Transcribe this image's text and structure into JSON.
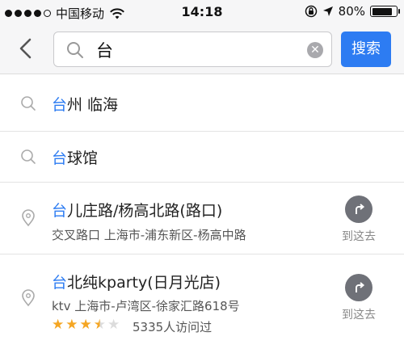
{
  "status_bar": {
    "carrier": "中国移动",
    "time": "14:18",
    "battery": "80%",
    "battery_level": 0.8
  },
  "search": {
    "query": "台",
    "button_label": "搜索"
  },
  "results": [
    {
      "type": "query",
      "highlight": "台",
      "rest": "州 临海",
      "icon": "search-icon"
    },
    {
      "type": "query",
      "highlight": "台",
      "rest": "球馆",
      "icon": "search-icon"
    },
    {
      "type": "place",
      "highlight": "台",
      "rest": "儿庄路/杨高北路(路口)",
      "subtitle": "交叉路口  上海市-浦东新区-杨高中路",
      "action_label": "到这去",
      "icon": "location-pin-icon"
    },
    {
      "type": "place",
      "highlight": "台",
      "rest": "北纯kparty(日月光店)",
      "subtitle": "ktv  上海市-卢湾区-徐家汇路618号",
      "rating": 3.5,
      "visits": "5335人访问过",
      "action_label": "到这去",
      "icon": "location-pin-icon"
    }
  ],
  "colors": {
    "accent": "#2d7cf2",
    "star": "#f5a623",
    "header_bg": "#f6f6f7"
  }
}
